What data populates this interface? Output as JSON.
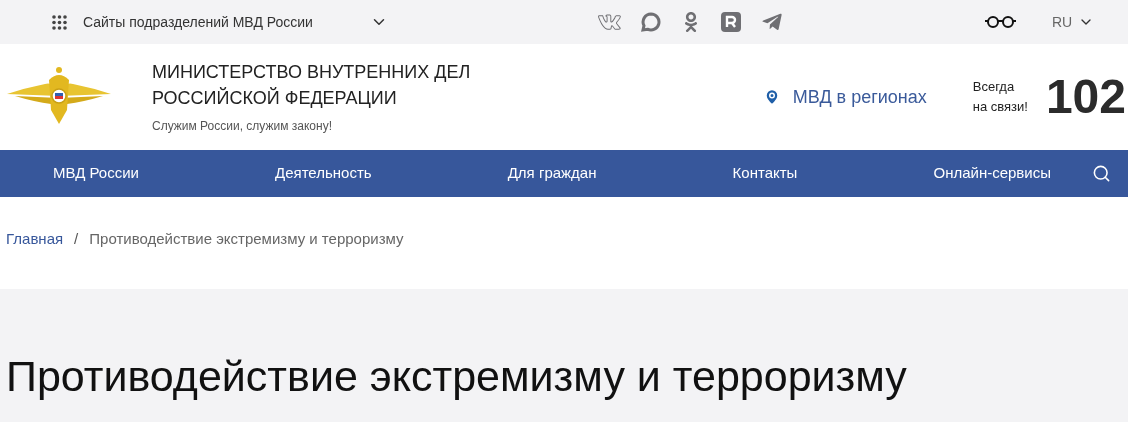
{
  "top_bar": {
    "sites_label": "Сайты подразделений МВД России",
    "language": "RU"
  },
  "header": {
    "title_line_1": "МИНИСТЕРСТВО ВНУТРЕННИХ ДЕЛ",
    "title_line_2": "РОССИЙСКОЙ ФЕДЕРАЦИИ",
    "slogan": "Служим России, служим закону!",
    "regions_link": "МВД в регионах",
    "hotline_line_1": "Всегда",
    "hotline_line_2": "на связи!",
    "hotline_number": "102"
  },
  "nav": [
    "МВД России",
    "Деятельность",
    "Для граждан",
    "Контакты",
    "Онлайн-сервисы"
  ],
  "breadcrumbs": [
    {
      "label": "Главная",
      "kind": "link"
    },
    {
      "label": "/",
      "kind": "separator"
    },
    {
      "label": "Противодействие экстремизму и терроризму",
      "kind": "current"
    }
  ],
  "page_title": "Противодействие экстремизму и терроризму"
}
